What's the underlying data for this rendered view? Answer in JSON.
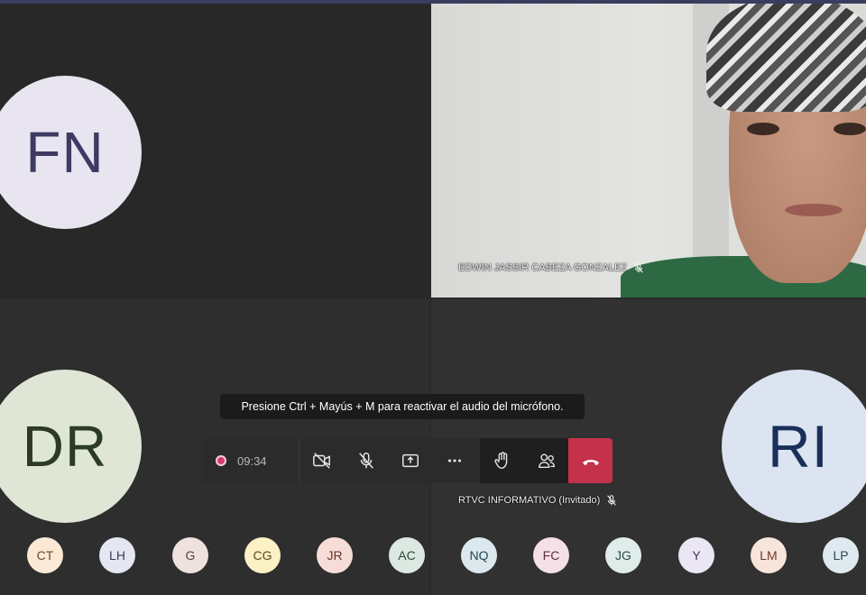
{
  "tiles": {
    "fn": {
      "initials": "FN"
    },
    "ed": {
      "name": "EDWIN JASSIR CABEZA GONZALEZ"
    },
    "dr": {
      "initials": "DR"
    },
    "ri": {
      "initials": "RI",
      "name": "RTVC INFORMATIVO (Invitado)"
    }
  },
  "tooltip": {
    "text": "Presione Ctrl + Mayús + M para reactivar el audio del micrófono."
  },
  "controls": {
    "timer": "09:34",
    "buttons": [
      "record-indicator",
      "camera-off-icon",
      "mic-off-icon",
      "share-screen-icon",
      "more-icon",
      "raise-hand-icon",
      "participants-icon",
      "hang-up-icon"
    ]
  },
  "roster": [
    {
      "initials": "CT",
      "bg": "#fbe9d6",
      "fg": "#6a4a2a"
    },
    {
      "initials": "LH",
      "bg": "#e4e6f1",
      "fg": "#3b3e5a"
    },
    {
      "initials": "G",
      "bg": "#efe2de",
      "fg": "#5a3b34"
    },
    {
      "initials": "CG",
      "bg": "#fbf0c6",
      "fg": "#5a4a1a"
    },
    {
      "initials": "JR",
      "bg": "#f6ddd8",
      "fg": "#6a2f28"
    },
    {
      "initials": "AC",
      "bg": "#dce9e2",
      "fg": "#2a4a3a"
    },
    {
      "initials": "NQ",
      "bg": "#dbe8ee",
      "fg": "#254556"
    },
    {
      "initials": "FC",
      "bg": "#f4e0e6",
      "fg": "#5e2f3c"
    },
    {
      "initials": "JG",
      "bg": "#e0ecea",
      "fg": "#2f4d4a"
    },
    {
      "initials": "Y",
      "bg": "#ebe6f3",
      "fg": "#45395e"
    },
    {
      "initials": "LM",
      "bg": "#f7e4db",
      "fg": "#6b3b2a"
    },
    {
      "initials": "LP",
      "bg": "#dfeaf0",
      "fg": "#2a4756"
    }
  ]
}
